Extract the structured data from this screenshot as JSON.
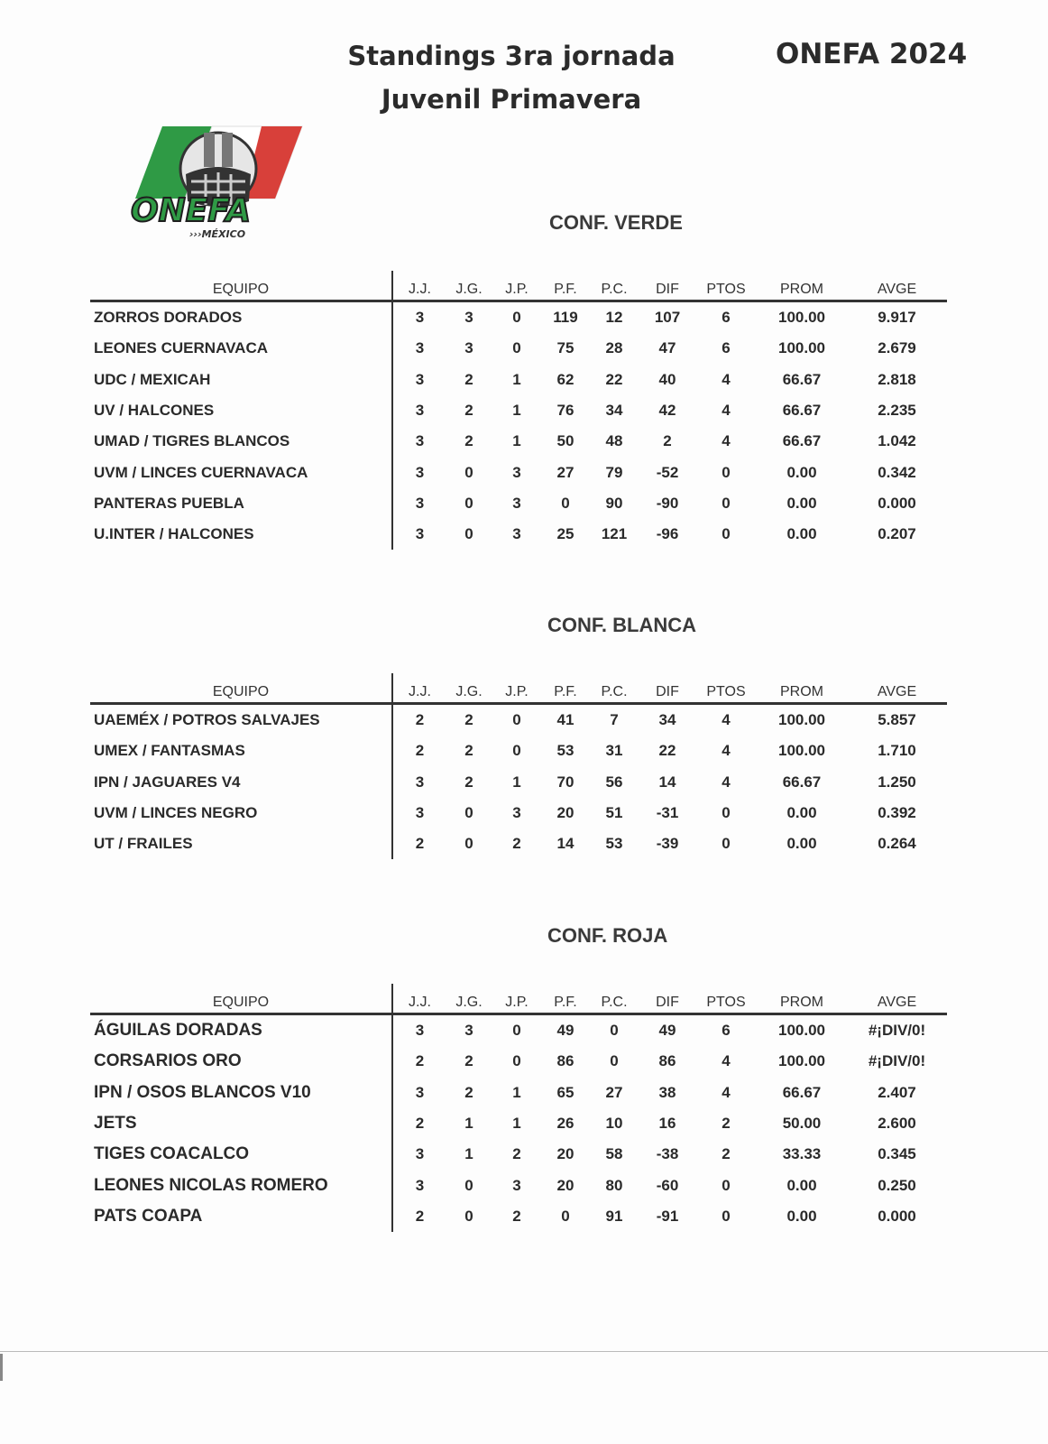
{
  "header": {
    "title_line1": "Standings 3ra jornada",
    "title_line2": "Juvenil Primavera",
    "org_year": "ONEFA 2024"
  },
  "logo": {
    "wordmark": "ONEFA",
    "subtitle": "›››MÉXICO"
  },
  "columns": [
    "EQUIPO",
    "J.J.",
    "J.G.",
    "J.P.",
    "P.F.",
    "P.C.",
    "DIF",
    "PTOS",
    "PROM",
    "AVGE"
  ],
  "conferences": [
    {
      "name": "CONF. VERDE",
      "rows": [
        [
          "ZORROS DORADOS",
          "3",
          "3",
          "0",
          "119",
          "12",
          "107",
          "6",
          "100.00",
          "9.917"
        ],
        [
          "LEONES CUERNAVACA",
          "3",
          "3",
          "0",
          "75",
          "28",
          "47",
          "6",
          "100.00",
          "2.679"
        ],
        [
          "UDC / MEXICAH",
          "3",
          "2",
          "1",
          "62",
          "22",
          "40",
          "4",
          "66.67",
          "2.818"
        ],
        [
          "UV / HALCONES",
          "3",
          "2",
          "1",
          "76",
          "34",
          "42",
          "4",
          "66.67",
          "2.235"
        ],
        [
          "UMAD / TIGRES BLANCOS",
          "3",
          "2",
          "1",
          "50",
          "48",
          "2",
          "4",
          "66.67",
          "1.042"
        ],
        [
          "UVM / LINCES CUERNAVACA",
          "3",
          "0",
          "3",
          "27",
          "79",
          "-52",
          "0",
          "0.00",
          "0.342"
        ],
        [
          "PANTERAS PUEBLA",
          "3",
          "0",
          "3",
          "0",
          "90",
          "-90",
          "0",
          "0.00",
          "0.000"
        ],
        [
          "U.INTER / HALCONES",
          "3",
          "0",
          "3",
          "25",
          "121",
          "-96",
          "0",
          "0.00",
          "0.207"
        ]
      ]
    },
    {
      "name": "CONF. BLANCA",
      "rows": [
        [
          "UAEMÉX / POTROS SALVAJES",
          "2",
          "2",
          "0",
          "41",
          "7",
          "34",
          "4",
          "100.00",
          "5.857"
        ],
        [
          "UMEX / FANTASMAS",
          "2",
          "2",
          "0",
          "53",
          "31",
          "22",
          "4",
          "100.00",
          "1.710"
        ],
        [
          "IPN / JAGUARES V4",
          "3",
          "2",
          "1",
          "70",
          "56",
          "14",
          "4",
          "66.67",
          "1.250"
        ],
        [
          "UVM / LINCES NEGRO",
          "3",
          "0",
          "3",
          "20",
          "51",
          "-31",
          "0",
          "0.00",
          "0.392"
        ],
        [
          "UT / FRAILES",
          "2",
          "0",
          "2",
          "14",
          "53",
          "-39",
          "0",
          "0.00",
          "0.264"
        ]
      ]
    },
    {
      "name": "CONF. ROJA",
      "rows": [
        [
          "ÁGUILAS DORADAS",
          "3",
          "3",
          "0",
          "49",
          "0",
          "49",
          "6",
          "100.00",
          "#¡DIV/0!"
        ],
        [
          "CORSARIOS ORO",
          "2",
          "2",
          "0",
          "86",
          "0",
          "86",
          "4",
          "100.00",
          "#¡DIV/0!"
        ],
        [
          "IPN / OSOS BLANCOS V10",
          "3",
          "2",
          "1",
          "65",
          "27",
          "38",
          "4",
          "66.67",
          "2.407"
        ],
        [
          "JETS",
          "2",
          "1",
          "1",
          "26",
          "10",
          "16",
          "2",
          "50.00",
          "2.600"
        ],
        [
          "TIGES COACALCO",
          "3",
          "1",
          "2",
          "20",
          "58",
          "-38",
          "2",
          "33.33",
          "0.345"
        ],
        [
          "LEONES NICOLAS ROMERO",
          "3",
          "0",
          "3",
          "20",
          "80",
          "-60",
          "0",
          "0.00",
          "0.250"
        ],
        [
          "PATS COAPA",
          "2",
          "0",
          "2",
          "0",
          "91",
          "-91",
          "0",
          "0.00",
          "0.000"
        ]
      ]
    }
  ]
}
